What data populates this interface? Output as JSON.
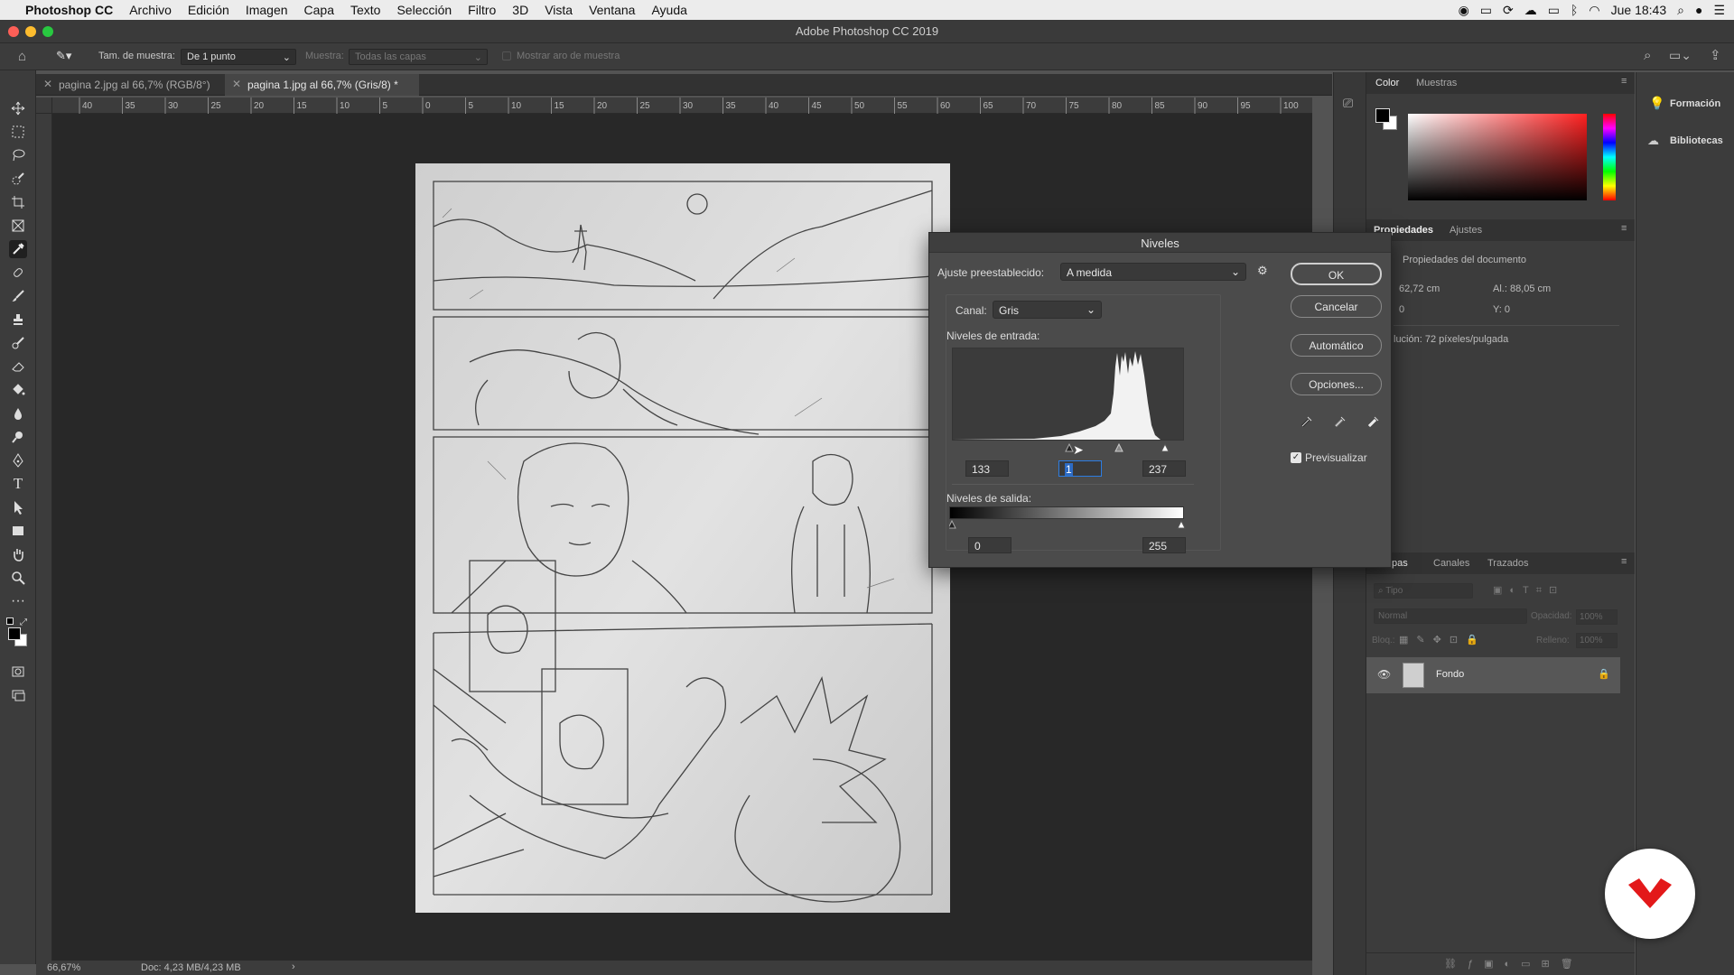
{
  "menubar": {
    "app": "Photoshop CC",
    "items": [
      "Archivo",
      "Edición",
      "Imagen",
      "Capa",
      "Texto",
      "Selección",
      "Filtro",
      "3D",
      "Vista",
      "Ventana",
      "Ayuda"
    ],
    "clock": "Jue 18:43"
  },
  "window": {
    "title": "Adobe Photoshop CC 2019"
  },
  "options": {
    "sample_size_label": "Tam. de muestra:",
    "sample_size_value": "De 1 punto",
    "sample_label": "Muestra:",
    "sample_value": "Todas las capas",
    "show_ring_label": "Mostrar aro de muestra"
  },
  "tabs": [
    {
      "label": "pagina 2.jpg al 66,7% (RGB/8°)"
    },
    {
      "label": "pagina 1.jpg al 66,7% (Gris/8) *"
    }
  ],
  "ruler": {
    "ticks": [
      "40",
      "35",
      "30",
      "25",
      "20",
      "15",
      "10",
      "5",
      "0",
      "5",
      "10",
      "15",
      "20",
      "25",
      "30",
      "35",
      "40",
      "45",
      "50",
      "55",
      "60",
      "65",
      "70",
      "75",
      "80",
      "85",
      "90",
      "95",
      "100"
    ]
  },
  "status": {
    "zoom": "66,67%",
    "doc": "Doc: 4,23 MB/4,23 MB"
  },
  "color_panel": {
    "tab_color": "Color",
    "tab_swatches": "Muestras",
    "fg": "#000000",
    "bg": "#ffffff",
    "hue": "#ff2020"
  },
  "properties_panel": {
    "tab_props": "Propiedades",
    "tab_adjust": "Ajustes",
    "heading": "Propiedades del documento",
    "width": "62,72 cm",
    "height_label": "Al.: 88,05 cm",
    "x": "0",
    "y": "Y: 0",
    "resolution": "lución: 72 píxeles/pulgada"
  },
  "layers_panel": {
    "tab_layers": "pas",
    "tab_channels": "Canales",
    "tab_paths": "Trazados",
    "filter_placeholder": "Tipo",
    "blend": "Normal",
    "opacity_label": "Opacidad:",
    "opacity": "100%",
    "lock_label": "Bloq.:",
    "fill_label": "Relleno:",
    "fill": "100%",
    "layer_name": "Fondo"
  },
  "side_panels": {
    "learn": "Formación",
    "libraries": "Bibliotecas"
  },
  "levels_dialog": {
    "title": "Niveles",
    "preset_label": "Ajuste preestablecido:",
    "preset_value": "A medida",
    "channel_label": "Canal:",
    "channel_value": "Gris",
    "input_label": "Niveles de entrada:",
    "input_black": "133",
    "input_gamma": "1",
    "input_white": "237",
    "output_label": "Niveles de salida:",
    "output_black": "0",
    "output_white": "255",
    "ok": "OK",
    "cancel": "Cancelar",
    "auto": "Automático",
    "options": "Opciones...",
    "preview_label": "Previsualizar",
    "preview_checked": true
  }
}
